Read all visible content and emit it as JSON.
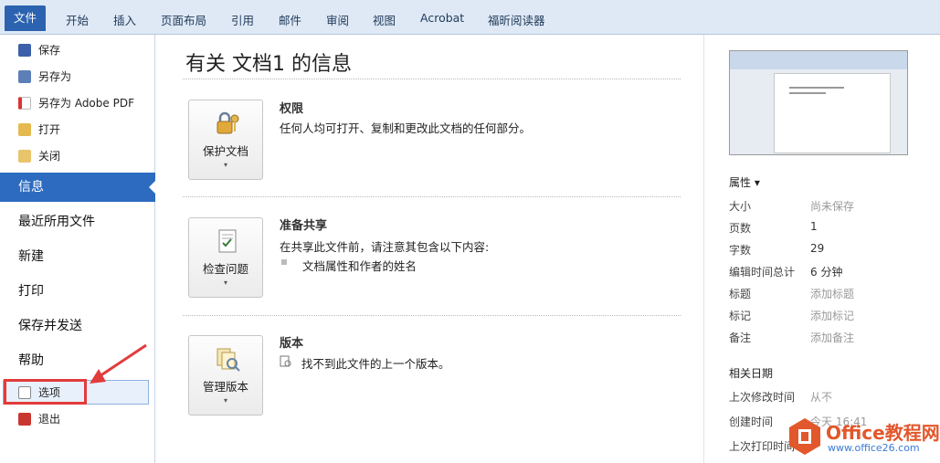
{
  "ribbon": {
    "tabs": [
      "文件",
      "开始",
      "插入",
      "页面布局",
      "引用",
      "邮件",
      "审阅",
      "视图",
      "Acrobat",
      "福昕阅读器"
    ]
  },
  "nav": {
    "commands": [
      {
        "label": "保存",
        "icon": "save-icon"
      },
      {
        "label": "另存为",
        "icon": "save-as-icon"
      },
      {
        "label": "另存为 Adobe PDF",
        "icon": "pdf-icon"
      },
      {
        "label": "打开",
        "icon": "open-folder-icon"
      },
      {
        "label": "关闭",
        "icon": "close-folder-icon"
      }
    ],
    "sections": [
      "信息",
      "最近所用文件",
      "新建",
      "打印",
      "保存并发送",
      "帮助"
    ],
    "options": "选项",
    "exit": "退出"
  },
  "info": {
    "title": "有关 文档1 的信息",
    "permissions": {
      "heading": "权限",
      "desc": "任何人均可打开、复制和更改此文档的任何部分。",
      "button": "保护文档",
      "arrow": "▾"
    },
    "prepare": {
      "heading": "准备共享",
      "desc": "在共享此文件前，请注意其包含以下内容:",
      "item": "文档属性和作者的姓名",
      "button": "检查问题",
      "arrow": "▾"
    },
    "versions": {
      "heading": "版本",
      "desc": "找不到此文件的上一个版本。",
      "button": "管理版本",
      "arrow": "▾"
    }
  },
  "properties": {
    "header": "属性 ▾",
    "rows": [
      {
        "label": "大小",
        "value": "尚未保存",
        "muted": true
      },
      {
        "label": "页数",
        "value": "1",
        "muted": false
      },
      {
        "label": "字数",
        "value": "29",
        "muted": false
      },
      {
        "label": "编辑时间总计",
        "value": "6 分钟",
        "muted": false
      },
      {
        "label": "标题",
        "value": "添加标题",
        "muted": true
      },
      {
        "label": "标记",
        "value": "添加标记",
        "muted": true
      },
      {
        "label": "备注",
        "value": "添加备注",
        "muted": true
      }
    ],
    "dates_header": "相关日期",
    "dates": [
      {
        "label": "上次修改时间",
        "value": "从不"
      },
      {
        "label": "创建时间",
        "value": "今天 16:41"
      },
      {
        "label": "上次打印时间",
        "value": ""
      }
    ]
  },
  "watermark": {
    "name": "Office教程网",
    "url": "www.office26.com"
  },
  "colors": {
    "accent": "#2c6bc0",
    "highlight": "#e23b3b",
    "brand": "#e2572b"
  }
}
